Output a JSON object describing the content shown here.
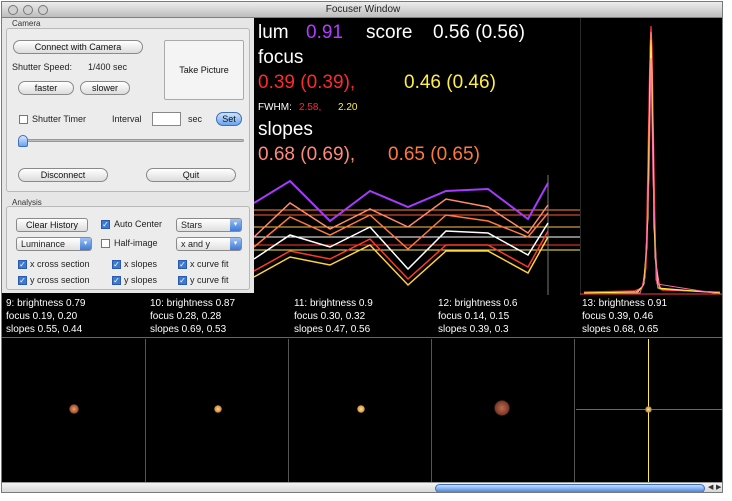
{
  "window": {
    "title": "Focuser Window"
  },
  "camera": {
    "section_label": "Camera",
    "connect_label": "Connect with Camera",
    "take_picture_label": "Take Picture",
    "shutter_label": "Shutter Speed:",
    "shutter_value": "1/400 sec",
    "faster_label": "faster",
    "slower_label": "slower",
    "timer_label": "Shutter Timer",
    "timer_checked": false,
    "interval_label": "Interval",
    "interval_value": "",
    "sec_label": "sec",
    "set_label": "Set",
    "disconnect_label": "Disconnect",
    "quit_label": "Quit"
  },
  "analysis": {
    "section_label": "Analysis",
    "clear_history_label": "Clear History",
    "auto_center_label": "Auto Center",
    "auto_center_checked": true,
    "mode_select": "Stars",
    "channel_select": "Luminance",
    "half_image_label": "Half-image",
    "half_image_checked": false,
    "axis_select": "x and y",
    "checks": [
      {
        "label": "x cross section",
        "checked": true
      },
      {
        "label": "x slopes",
        "checked": true
      },
      {
        "label": "x curve fit",
        "checked": true
      },
      {
        "label": "y cross section",
        "checked": true
      },
      {
        "label": "y slopes",
        "checked": true
      },
      {
        "label": "y curve fit",
        "checked": true
      }
    ]
  },
  "readout": {
    "lum_label": "lum",
    "lum_value": "0.91",
    "score_label": "score",
    "score_value": "0.56 (0.56)",
    "focus_label": "focus",
    "focus_x": "0.39 (0.39),",
    "focus_y": "0.46 (0.46)",
    "fwhm_label": "FWHM:",
    "fwhm_x": "2.58,",
    "fwhm_y": "2.20",
    "slopes_label": "slopes",
    "slopes_x": "0.68 (0.69),",
    "slopes_y": "0.65 (0.65)"
  },
  "colors": {
    "lum": "#b43cff",
    "focus_x": "#ff2a2a",
    "focus_y": "#ffee44",
    "slopes": "#ff7a4a",
    "white": "#ffffff"
  },
  "frames": [
    {
      "brightness_line": "9: brightness 0.79",
      "focus_line": "focus 0.19, 0.20",
      "slopes_line": "slopes 0.55, 0.44"
    },
    {
      "brightness_line": "10: brightness 0.87",
      "focus_line": "focus 0.28, 0.28",
      "slopes_line": "slopes 0.69, 0.53"
    },
    {
      "brightness_line": "11: brightness 0.9",
      "focus_line": "focus 0.30, 0.32",
      "slopes_line": "slopes 0.47, 0.56"
    },
    {
      "brightness_line": "12: brightness 0.6",
      "focus_line": "focus 0.14, 0.15",
      "slopes_line": "slopes 0.39, 0.3"
    },
    {
      "brightness_line": "13: brightness 0.91",
      "focus_line": "focus 0.39, 0.46",
      "slopes_line": "slopes 0.68, 0.65"
    }
  ]
}
